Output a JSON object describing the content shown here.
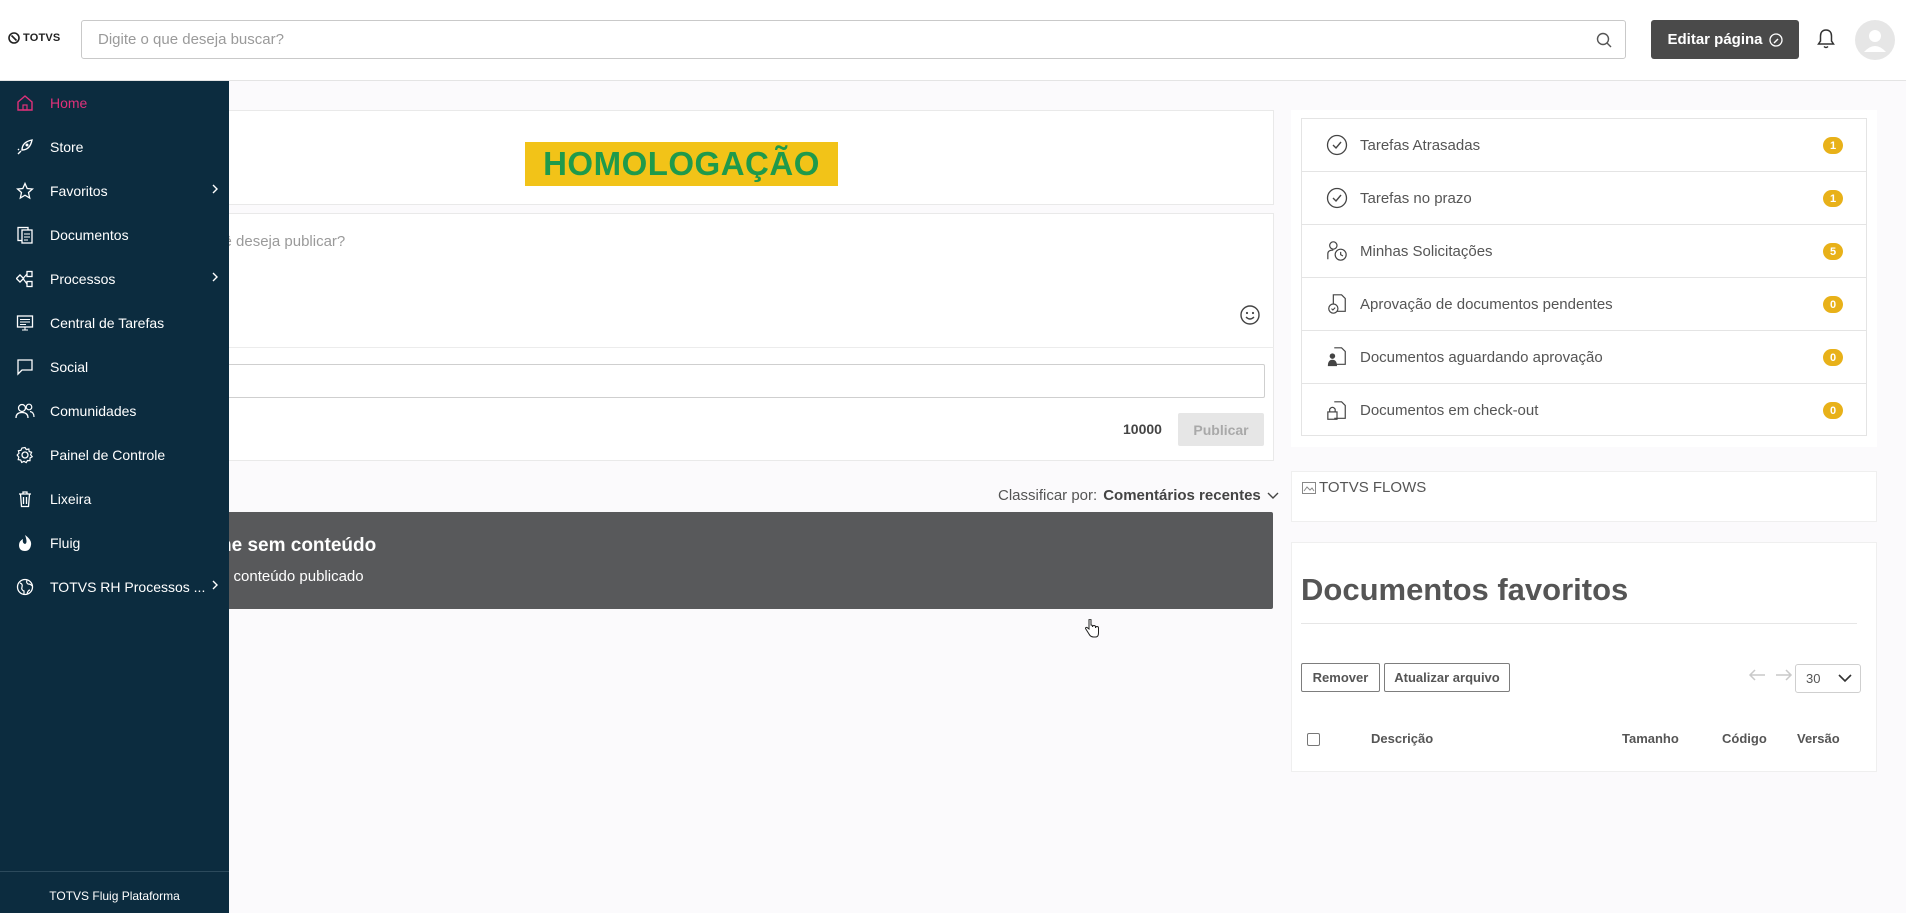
{
  "header": {
    "logo_text": "TOTVS",
    "search_placeholder": "Digite o que deseja buscar?",
    "edit_page_label": "Editar página"
  },
  "sidebar": {
    "items": [
      {
        "label": "Home",
        "icon": "home-icon",
        "active": true
      },
      {
        "label": "Store",
        "icon": "rocket-icon"
      },
      {
        "label": "Favoritos",
        "icon": "star-icon",
        "has_submenu": true
      },
      {
        "label": "Documentos",
        "icon": "documents-icon"
      },
      {
        "label": "Processos",
        "icon": "process-icon",
        "has_submenu": true
      },
      {
        "label": "Central de Tarefas",
        "icon": "task-center-icon"
      },
      {
        "label": "Social",
        "icon": "chat-icon"
      },
      {
        "label": "Comunidades",
        "icon": "people-icon"
      },
      {
        "label": "Painel de Controle",
        "icon": "gear-icon"
      },
      {
        "label": "Lixeira",
        "icon": "trash-icon"
      },
      {
        "label": "Fluig",
        "icon": "fluig-icon"
      },
      {
        "label": "TOTVS RH Processos ...",
        "icon": "globe-icon",
        "has_submenu": true
      }
    ],
    "footer": "TOTVS Fluig Plataforma"
  },
  "main": {
    "banner_text": "HOMOLOGAÇÃO",
    "composer_placeholder": "cê deseja publicar?",
    "char_count": "10000",
    "publish_label": "Publicar",
    "sort_label": "Classificar por:",
    "sort_value": "Comentários recentes",
    "empty_title": "ne sem conteúdo",
    "empty_subtitle": "e conteúdo publicado"
  },
  "tasks": [
    {
      "label": "Tarefas Atrasadas",
      "count": "1",
      "icon": "clock-check-icon"
    },
    {
      "label": "Tarefas no prazo",
      "count": "1",
      "icon": "clock-check-icon"
    },
    {
      "label": "Minhas Solicitações",
      "count": "5",
      "icon": "user-clock-icon"
    },
    {
      "label": "Aprovação de documentos pendentes",
      "count": "0",
      "icon": "doc-clock-icon"
    },
    {
      "label": "Documentos aguardando aprovação",
      "count": "0",
      "icon": "doc-user-icon"
    },
    {
      "label": "Documentos em check-out",
      "count": "0",
      "icon": "doc-lock-icon"
    }
  ],
  "flows": {
    "alt_text": "TOTVS FLOWS"
  },
  "favorite_docs": {
    "title": "Documentos favoritos",
    "remove_label": "Remover",
    "update_label": "Atualizar arquivo",
    "page_size": "30",
    "columns": [
      "Descrição",
      "Tamanho",
      "Código",
      "Versão"
    ]
  },
  "colors": {
    "sidebar_bg": "#0c2c3f",
    "active_nav": "#e0317a",
    "banner_bg": "#f2c318",
    "banner_text": "#1f9a4b",
    "badge": "#e8b119"
  }
}
